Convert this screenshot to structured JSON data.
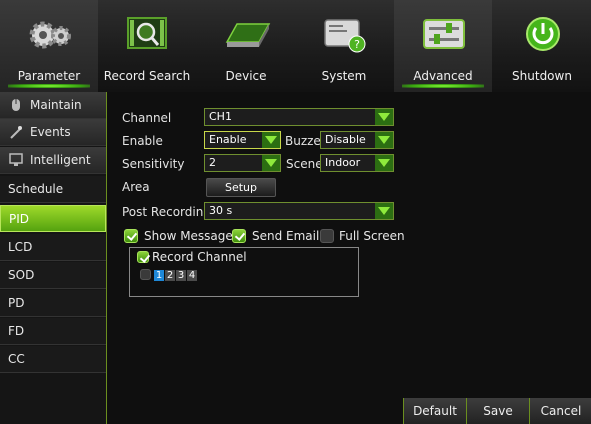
{
  "tabs": [
    {
      "label": "Parameter",
      "icon": "gears-icon"
    },
    {
      "label": "Record Search",
      "icon": "film-search-icon"
    },
    {
      "label": "Device",
      "icon": "hard-drive-icon"
    },
    {
      "label": "System",
      "icon": "system-info-icon"
    },
    {
      "label": "Advanced",
      "icon": "sliders-icon"
    },
    {
      "label": "Shutdown",
      "icon": "power-icon"
    }
  ],
  "sidebar": {
    "items": [
      {
        "label": "Maintain"
      },
      {
        "label": "Events"
      },
      {
        "label": "Intelligent"
      },
      {
        "label": "Schedule"
      },
      {
        "label": "PID"
      },
      {
        "label": "LCD"
      },
      {
        "label": "SOD"
      },
      {
        "label": "PD"
      },
      {
        "label": "FD"
      },
      {
        "label": "CC"
      }
    ]
  },
  "form": {
    "channel_label": "Channel",
    "channel_value": "CH1",
    "enable_label": "Enable",
    "enable_value": "Enable",
    "buzzer_label": "Buzzer",
    "buzzer_value": "Disable",
    "sensitivity_label": "Sensitivity",
    "sensitivity_value": "2",
    "scene_label": "Scene",
    "scene_value": "Indoor",
    "area_label": "Area",
    "setup_label": "Setup",
    "post_label": "Post Recording",
    "post_value": "30 s",
    "show_message": "Show Message",
    "send_email": "Send Email",
    "full_screen": "Full Screen",
    "record_channel": "Record Channel",
    "channels": [
      "1",
      "2",
      "3",
      "4"
    ]
  },
  "footer": {
    "default": "Default",
    "save": "Save",
    "cancel": "Cancel"
  },
  "colors": {
    "accent": "#5fb31a",
    "selected_channel": "#1e88d8"
  }
}
